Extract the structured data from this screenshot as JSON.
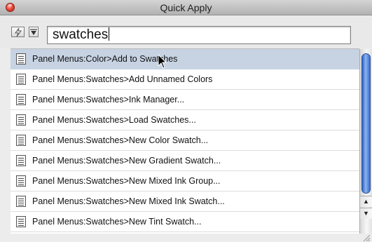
{
  "window": {
    "title": "Quick Apply"
  },
  "search": {
    "value": "swatches"
  },
  "toolbar": {
    "icons": [
      "lightning-bolt-icon",
      "filter-menu-icon"
    ]
  },
  "results": [
    {
      "label": "Panel Menus:Color>Add to Swatches",
      "selected": true
    },
    {
      "label": "Panel Menus:Swatches>Add Unnamed Colors",
      "selected": false
    },
    {
      "label": "Panel Menus:Swatches>Ink Manager...",
      "selected": false
    },
    {
      "label": "Panel Menus:Swatches>Load Swatches...",
      "selected": false
    },
    {
      "label": "Panel Menus:Swatches>New Color Swatch...",
      "selected": false
    },
    {
      "label": "Panel Menus:Swatches>New Gradient Swatch...",
      "selected": false
    },
    {
      "label": "Panel Menus:Swatches>New Mixed Ink Group...",
      "selected": false
    },
    {
      "label": "Panel Menus:Swatches>New Mixed Ink Swatch...",
      "selected": false
    },
    {
      "label": "Panel Menus:Swatches>New Tint Swatch...",
      "selected": false
    }
  ],
  "colors": {
    "selection": "#c7d3e3",
    "scroll_thumb": "#3a6dd0",
    "close_button": "#ec4b3c"
  }
}
